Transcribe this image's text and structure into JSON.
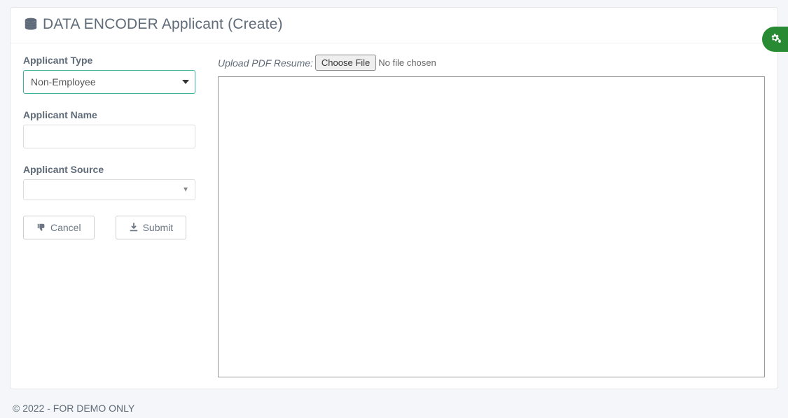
{
  "header": {
    "title": "DATA ENCODER Applicant (Create)"
  },
  "form": {
    "applicant_type_label": "Applicant Type",
    "applicant_type_value": "Non-Employee",
    "applicant_name_label": "Applicant Name",
    "applicant_name_value": "",
    "applicant_source_label": "Applicant Source",
    "applicant_source_value": ""
  },
  "buttons": {
    "cancel": "Cancel",
    "submit": "Submit"
  },
  "upload": {
    "label": "Upload PDF Resume:",
    "choose_file": "Choose File",
    "status": "No file chosen"
  },
  "footer": {
    "text": "© 2022 - FOR DEMO ONLY"
  }
}
